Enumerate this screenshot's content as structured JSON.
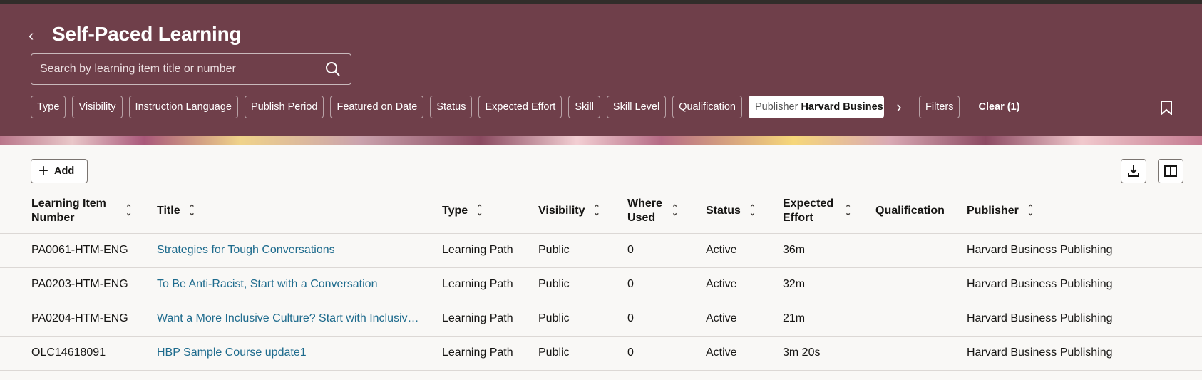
{
  "header": {
    "title": "Self-Paced Learning",
    "search_placeholder": "Search by learning item title or number",
    "filters": [
      "Type",
      "Visibility",
      "Instruction Language",
      "Publish Period",
      "Featured on Date",
      "Status",
      "Expected Effort",
      "Skill",
      "Skill Level",
      "Qualification"
    ],
    "publisher_filter": {
      "label": "Publisher",
      "value": "Harvard Business Publishing"
    },
    "filters_button": "Filters",
    "clear_button": "Clear (1)"
  },
  "toolbar": {
    "add_label": "Add"
  },
  "table": {
    "columns": {
      "number": "Learning Item Number",
      "title": "Title",
      "type": "Type",
      "visibility": "Visibility",
      "where_used": "Where Used",
      "status": "Status",
      "effort": "Expected Effort",
      "qualification": "Qualification",
      "publisher": "Publisher"
    },
    "rows": [
      {
        "number": "PA0061-HTM-ENG",
        "title": "Strategies for Tough Conversations",
        "type": "Learning Path",
        "visibility": "Public",
        "where_used": "0",
        "status": "Active",
        "effort": "36m",
        "qualification": "",
        "publisher": "Harvard Business Publishing"
      },
      {
        "number": "PA0203-HTM-ENG",
        "title": "To Be Anti-Racist, Start with a Conversation",
        "type": "Learning Path",
        "visibility": "Public",
        "where_used": "0",
        "status": "Active",
        "effort": "32m",
        "qualification": "",
        "publisher": "Harvard Business Publishing"
      },
      {
        "number": "PA0204-HTM-ENG",
        "title": "Want a More Inclusive Culture? Start with Inclusive Meetings",
        "type": "Learning Path",
        "visibility": "Public",
        "where_used": "0",
        "status": "Active",
        "effort": "21m",
        "qualification": "",
        "publisher": "Harvard Business Publishing"
      },
      {
        "number": "OLC14618091",
        "title": "HBP Sample Course update1",
        "type": "Learning Path",
        "visibility": "Public",
        "where_used": "0",
        "status": "Active",
        "effort": "3m 20s",
        "qualification": "",
        "publisher": "Harvard Business Publishing"
      }
    ]
  },
  "colors": {
    "header_bg": "#6f3f4a",
    "link": "#1e6b8d"
  }
}
